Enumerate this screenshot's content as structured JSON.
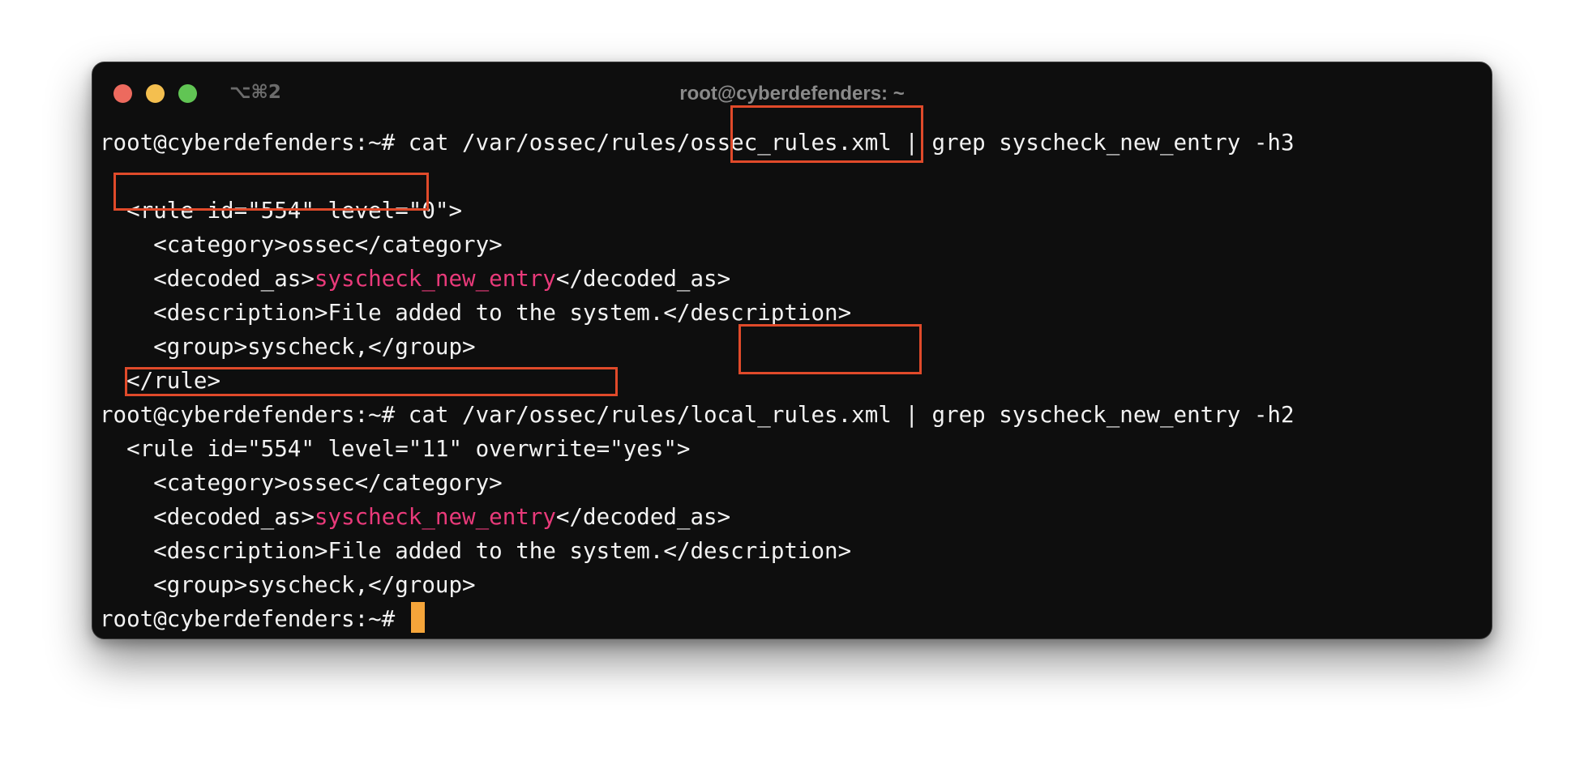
{
  "window": {
    "title": "root@cyberdefenders: ~",
    "shortcut": "⌥⌘2",
    "traffic_lights": {
      "close_color": "#ed6a5e",
      "minimize_color": "#f4bf4f",
      "zoom_color": "#61c554"
    }
  },
  "colors": {
    "background": "#0e0e0e",
    "text": "#f2f2f2",
    "match_highlight": "#e93a7a",
    "cursor": "#f5a53a",
    "annotation_box": "#e04a2a"
  },
  "terminal": {
    "lines": [
      {
        "parts": [
          {
            "t": "root@cyberdefenders:~# cat /var/ossec/rules/ossec_rules.xml | grep syscheck_new_entry -h3"
          }
        ]
      },
      {
        "parts": [
          {
            "t": ""
          }
        ]
      },
      {
        "parts": [
          {
            "t": "  <rule id=\"554\" level=\"0\">"
          }
        ]
      },
      {
        "parts": [
          {
            "t": "    <category>ossec</category>"
          }
        ]
      },
      {
        "parts": [
          {
            "t": "    <decoded_as>"
          },
          {
            "t": "syscheck_new_entry",
            "hl": true
          },
          {
            "t": "</decoded_as>"
          }
        ]
      },
      {
        "parts": [
          {
            "t": "    <description>File added to the system.</description>"
          }
        ]
      },
      {
        "parts": [
          {
            "t": "    <group>syscheck,</group>"
          }
        ]
      },
      {
        "parts": [
          {
            "t": "  </rule>"
          }
        ]
      },
      {
        "parts": [
          {
            "t": "root@cyberdefenders:~# cat /var/ossec/rules/local_rules.xml | grep syscheck_new_entry -h2"
          }
        ]
      },
      {
        "parts": [
          {
            "t": "  <rule id=\"554\" level=\"11\" overwrite=\"yes\">"
          }
        ]
      },
      {
        "parts": [
          {
            "t": "    <category>ossec</category>"
          }
        ]
      },
      {
        "parts": [
          {
            "t": "    <decoded_as>"
          },
          {
            "t": "syscheck_new_entry",
            "hl": true
          },
          {
            "t": "</decoded_as>"
          }
        ]
      },
      {
        "parts": [
          {
            "t": "    <description>File added to the system.</description>"
          }
        ]
      },
      {
        "parts": [
          {
            "t": "    <group>syscheck,</group>"
          }
        ]
      },
      {
        "parts": [
          {
            "t": "root@cyberdefenders:~# "
          }
        ],
        "cursor": true
      }
    ]
  }
}
